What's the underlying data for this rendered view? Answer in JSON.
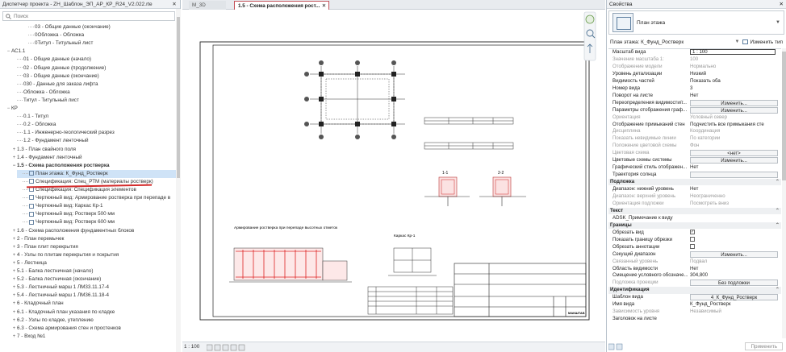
{
  "project_browser": {
    "title": "Диспетчер проекта - ZH_Шаблон_ЭП_АР_КР_R24_V2.022.rte",
    "close": "✕",
    "search_placeholder": "Поиск",
    "rows": [
      {
        "indent": 4,
        "toggle": "",
        "label": "03 - Общие данные (окончание)"
      },
      {
        "indent": 4,
        "toggle": "",
        "label": "0Обложка - Обложка"
      },
      {
        "indent": 4,
        "toggle": "",
        "label": "0Титул - Титульный лист"
      },
      {
        "indent": 1,
        "toggle": "−",
        "label": "АС1.1"
      },
      {
        "indent": 2,
        "toggle": "",
        "label": "01 - Общие данные (начало)"
      },
      {
        "indent": 2,
        "toggle": "",
        "label": "02 - Общие данные (продолжение)"
      },
      {
        "indent": 2,
        "toggle": "",
        "label": "03 - Общие данные (окончание)"
      },
      {
        "indent": 2,
        "toggle": "",
        "label": "030 - Данные для заказа лифта"
      },
      {
        "indent": 2,
        "toggle": "",
        "label": "Обложка - Обложка"
      },
      {
        "indent": 2,
        "toggle": "",
        "label": "Титул - Титульный лист"
      },
      {
        "indent": 1,
        "toggle": "−",
        "label": "КР"
      },
      {
        "indent": 2,
        "toggle": "",
        "label": "0.1 - Титул"
      },
      {
        "indent": 2,
        "toggle": "",
        "label": "0.2 - Обложка"
      },
      {
        "indent": 2,
        "toggle": "",
        "label": "1.1 - Инженерно-геологический разрез"
      },
      {
        "indent": 2,
        "toggle": "",
        "label": "1.2 - Фундамент ленточный"
      },
      {
        "indent": 2,
        "toggle": "+",
        "label": "1.3 - План свайного поля"
      },
      {
        "indent": 2,
        "toggle": "+",
        "label": "1.4 - Фундамент ленточный"
      },
      {
        "indent": 2,
        "toggle": "−",
        "label": "1.5 - Схема расположения ростверка",
        "bold": true
      },
      {
        "indent": 3,
        "toggle": "",
        "label": "План этажа: К_Фунд_Ростверк",
        "selected": true
      },
      {
        "indent": 3,
        "toggle": "",
        "label": "Спецификация: Спец_РТМ (материалы ростверк)"
      },
      {
        "indent": 3,
        "toggle": "",
        "label": "Спецификация: Спецификация элементов"
      },
      {
        "indent": 3,
        "toggle": "",
        "label": "Чертежный вид: Армирование ростверка при перепаде в"
      },
      {
        "indent": 3,
        "toggle": "",
        "label": "Чертежный вид: Каркас Кр-1"
      },
      {
        "indent": 3,
        "toggle": "",
        "label": "Чертежный вид: Ростверк 500 мм"
      },
      {
        "indent": 3,
        "toggle": "",
        "label": "Чертежный вид: Ростверк 600 мм"
      },
      {
        "indent": 2,
        "toggle": "+",
        "label": "1.6 - Схема расположения фундаментных блоков"
      },
      {
        "indent": 2,
        "toggle": "+",
        "label": "2 - План перемычек"
      },
      {
        "indent": 2,
        "toggle": "+",
        "label": "3 - План плит перекрытия"
      },
      {
        "indent": 2,
        "toggle": "+",
        "label": "4 - Узлы по плитам перекрытия и покрытия"
      },
      {
        "indent": 2,
        "toggle": "+",
        "label": "5 - Лестница"
      },
      {
        "indent": 2,
        "toggle": "+",
        "label": "5.1 - Балка лестничная (начало)"
      },
      {
        "indent": 2,
        "toggle": "+",
        "label": "5.2 - Балка лестничная (окончание)"
      },
      {
        "indent": 2,
        "toggle": "+",
        "label": "5.3 - Лестничный марш 1 ЛМ33.11.17-4"
      },
      {
        "indent": 2,
        "toggle": "+",
        "label": "5.4 - Лестничный марш 1 ЛМ36.11.18-4"
      },
      {
        "indent": 2,
        "toggle": "+",
        "label": "6 - Кладочный план"
      },
      {
        "indent": 2,
        "toggle": "+",
        "label": "6.1 - Кладочный план указания по кладке"
      },
      {
        "indent": 2,
        "toggle": "+",
        "label": "6.2 - Узлы по кладке, утеплению"
      },
      {
        "indent": 2,
        "toggle": "+",
        "label": "6.3 - Схема армирования стен и простенков"
      },
      {
        "indent": 2,
        "toggle": "+",
        "label": "7 - Вход №1"
      }
    ]
  },
  "tabs": [
    {
      "label": "М_3D",
      "active": false
    },
    {
      "label": "1.5 - Схема расположения рост...",
      "active": true
    }
  ],
  "tab_close": "✕",
  "drawing": {
    "detail1_title": "Армирование ростверка при перепаде высотных отметок",
    "detail2_title": "Каркас Кр-1",
    "section1": "1-1",
    "section2": "2-2",
    "tb_right_code": "МАКШТАБ"
  },
  "status_bar": {
    "scale": "1 : 100"
  },
  "properties": {
    "title": "Свойства",
    "close": "✕",
    "type_name": "План этажа",
    "instance_label": "План этажа: К_Фунд_Ростверк",
    "edit_type": "Изменить тип",
    "rows": [
      {
        "kind": "box",
        "name": "Масштаб вида",
        "value": "1 : 100"
      },
      {
        "kind": "text",
        "name": "Значение масштаба    1:",
        "value": "100",
        "disabled": true
      },
      {
        "kind": "text",
        "name": "Отображение модели",
        "value": "Нормально",
        "disabled": true
      },
      {
        "kind": "text",
        "name": "Уровень детализации",
        "value": "Низкий"
      },
      {
        "kind": "text",
        "name": "Видимость частей",
        "value": "Показать оба"
      },
      {
        "kind": "text",
        "name": "Номер вида",
        "value": "3"
      },
      {
        "kind": "text",
        "name": "Поворот на листе",
        "value": "Нет"
      },
      {
        "kind": "button",
        "name": "Переопределения видимости/г...",
        "value": "Изменить..."
      },
      {
        "kind": "button",
        "name": "Параметры отображения граф...",
        "value": "Изменить..."
      },
      {
        "kind": "text",
        "name": "Ориентация",
        "value": "Условный север",
        "disabled": true
      },
      {
        "kind": "text",
        "name": "Отображение примыканий стен",
        "value": "Подчистить все примыкания сте"
      },
      {
        "kind": "text",
        "name": "Дисциплина",
        "value": "Координация",
        "disabled": true
      },
      {
        "kind": "text",
        "name": "Показать невидимые линии",
        "value": "По категории",
        "disabled": true
      },
      {
        "kind": "text",
        "name": "Положение цветовой схемы",
        "value": "Фон",
        "disabled": true
      },
      {
        "kind": "button",
        "name": "Цветовая схема",
        "value": "<нет>",
        "disabled": true
      },
      {
        "kind": "button",
        "name": "Цветовые схемы системы",
        "value": "Изменить..."
      },
      {
        "kind": "text",
        "name": "Графический стиль отображен...",
        "value": "Нет"
      },
      {
        "kind": "button",
        "name": "Траектория солнца",
        "value": ""
      },
      {
        "kind": "group",
        "name": "Подложка"
      },
      {
        "kind": "text",
        "name": "Диапазон: нижний уровень",
        "value": "Нет"
      },
      {
        "kind": "text",
        "name": "Диапазон: верхний уровень",
        "value": "Неограниченно",
        "disabled": true
      },
      {
        "kind": "text",
        "name": "Ориентация подложки",
        "value": "Посмотреть вниз",
        "disabled": true
      },
      {
        "kind": "group",
        "name": "Текст"
      },
      {
        "kind": "text",
        "name": "ADSK_Примечание к виду",
        "value": ""
      },
      {
        "kind": "group",
        "name": "Границы"
      },
      {
        "kind": "check",
        "name": "Обрезать вид",
        "value": "✓"
      },
      {
        "kind": "check",
        "name": "Показать границу обрезки",
        "value": ""
      },
      {
        "kind": "check",
        "name": "Обрезать аннотации",
        "value": ""
      },
      {
        "kind": "button",
        "name": "Секущий диапазон",
        "value": "Изменить..."
      },
      {
        "kind": "text",
        "name": "Связанный уровень",
        "value": "Подвал",
        "disabled": true
      },
      {
        "kind": "text",
        "name": "Область видимости",
        "value": "Нет"
      },
      {
        "kind": "text",
        "name": "Смещение условного обозначе...",
        "value": "304,800"
      },
      {
        "kind": "button",
        "name": "Подложка проекции",
        "value": "Без подложки",
        "disabled": true
      },
      {
        "kind": "group",
        "name": "Идентификация"
      },
      {
        "kind": "button",
        "name": "Шаблон вида",
        "value": "4_К_Фунд_Ростверк"
      },
      {
        "kind": "text",
        "name": "Имя вида",
        "value": "К_Фунд_Ростверк"
      },
      {
        "kind": "text",
        "name": "Зависимость уровня",
        "value": "Независимый",
        "disabled": true
      },
      {
        "kind": "text",
        "name": "Заголовок на листе",
        "value": ""
      }
    ],
    "apply": "Применить"
  }
}
